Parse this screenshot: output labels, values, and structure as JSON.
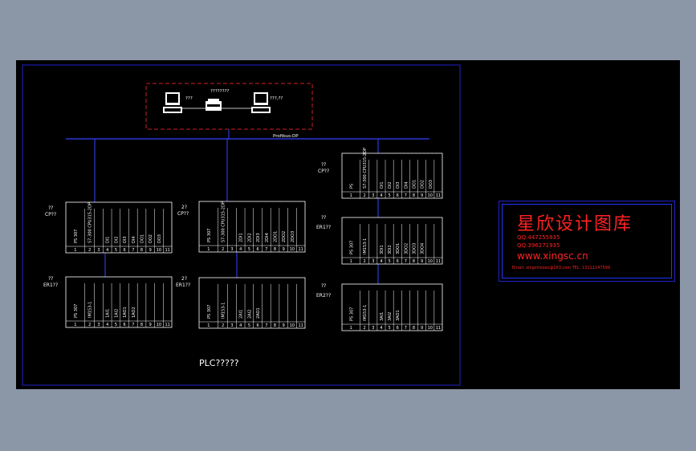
{
  "network": {
    "bus_label": "Profibus-DP",
    "pc_left_label": "???",
    "pc_right_label": "???,??",
    "printer_label": "????????",
    "bottom_title": "PLC?????"
  },
  "stations": [
    {
      "id": "cp1",
      "label_top": "??",
      "label_bottom": "CP??",
      "modules": [
        "PS 307",
        "S7-300 CPU315-2DP",
        "",
        "DI1",
        "DI2",
        "DI3",
        "DI4",
        "DO1",
        "DO2",
        "DO3"
      ],
      "slots": [
        "1",
        "2",
        "3",
        "4",
        "5",
        "6",
        "7",
        "8",
        "9",
        "10",
        "11"
      ]
    },
    {
      "id": "cp2",
      "label_top": "2?",
      "label_bottom": "CP??",
      "modules": [
        "PS 307",
        "S7-300 CPU315-2DP",
        "",
        "2DI1",
        "2DI2",
        "2DI3",
        "2DI4",
        "2DO1",
        "2DO2",
        "2DO3"
      ],
      "slots": [
        "1",
        "2",
        "3",
        "4",
        "5",
        "6",
        "7",
        "8",
        "9",
        "10",
        "11"
      ]
    },
    {
      "id": "cp3",
      "label_top": "??",
      "label_bottom": "CP??",
      "modules": [
        "PS",
        "S7-300 CPU315-2DP",
        "",
        "DI1",
        "DI2",
        "DI3",
        "DI4",
        "DO1",
        "DO2",
        "DO3"
      ],
      "slots": [
        "1",
        "2",
        "3",
        "4",
        "5",
        "6",
        "7",
        "8",
        "9",
        "10",
        "11"
      ]
    },
    {
      "id": "er1",
      "label_top": "??",
      "label_bottom": "ER1??",
      "modules": [
        "PS 307",
        "IM153-1",
        "",
        "1AI1",
        "1AI2",
        "1AO1",
        "1AO2"
      ],
      "slots": [
        "1",
        "2",
        "3",
        "4",
        "5",
        "6",
        "7",
        "8",
        "9",
        "10",
        "11"
      ]
    },
    {
      "id": "er2",
      "label_top": "2?",
      "label_bottom": "ER1??",
      "modules": [
        "PS 307",
        "IM153-1",
        "",
        "2AI1",
        "2AI2",
        "2AO1"
      ],
      "slots": [
        "1",
        "2",
        "3",
        "4",
        "5",
        "6",
        "7",
        "8",
        "9",
        "10",
        "11"
      ]
    },
    {
      "id": "er3",
      "label_top": "??",
      "label_bottom": "ER1??",
      "modules": [
        "PS 307",
        "IM153-1",
        "",
        "3DI1",
        "3DI2",
        "3DO1",
        "3DO2",
        "3DO3",
        "3DO4"
      ],
      "slots": [
        "1",
        "2",
        "3",
        "4",
        "5",
        "6",
        "7",
        "8",
        "9",
        "10",
        "11"
      ]
    },
    {
      "id": "er4",
      "label_top": "??",
      "label_bottom": "ER2??",
      "modules": [
        "PS 307",
        "IM153-1",
        "",
        "3AI1",
        "3AI2",
        "3AO1"
      ],
      "slots": [
        "1",
        "2",
        "3",
        "4",
        "5",
        "6",
        "7",
        "8",
        "9",
        "10",
        "11"
      ]
    }
  ],
  "logo": {
    "title": "星欣设计图库",
    "qq1": "QQ:447255935",
    "qq2": "QQ:396271935",
    "url": "www.xingsc.cn",
    "contact": "Email: xingshisoso@163.com  TEL: 13111147599"
  },
  "colors": {
    "background": "#8b96a6",
    "canvas": "#000000",
    "frame": "#2222cc",
    "bus": "#3344ff",
    "lines": "#ffffff",
    "dashed": "#cc2222",
    "logo_text": "#ff2222"
  }
}
